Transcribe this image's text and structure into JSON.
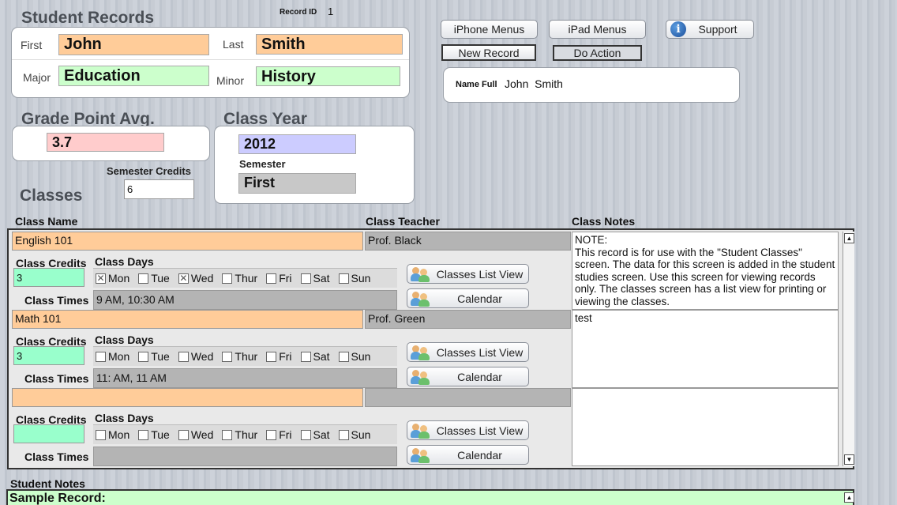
{
  "header": {
    "title": "Student Records",
    "record_id_label": "Record ID",
    "record_id": "1"
  },
  "name": {
    "first_label": "First",
    "first": "John",
    "last_label": "Last",
    "last": "Smith",
    "major_label": "Major",
    "major": "Education",
    "minor_label": "Minor",
    "minor": "History"
  },
  "toolbar": {
    "iphone_menus": "iPhone Menus",
    "ipad_menus": "iPad Menus",
    "support": "Support",
    "new_record": "New Record",
    "do_action": "Do Action"
  },
  "name_full": {
    "label": "Name Full",
    "value": "John  Smith"
  },
  "gpa": {
    "label": "Grade Point Avg.",
    "value": "3.7",
    "semester_credits_label": "Semester Credits",
    "semester_credits": "6"
  },
  "class_year": {
    "label": "Class Year",
    "value": "2012",
    "semester_label": "Semester",
    "semester": "First"
  },
  "classes": {
    "label": "Classes",
    "col_name": "Class Name",
    "col_teacher": "Class Teacher",
    "col_notes": "Class Notes",
    "credits_label": "Class Credits",
    "days_label": "Class Days",
    "times_label": "Class Times",
    "list_view_label": "Classes List View",
    "calendar_label": "Calendar",
    "day_names": [
      "Mon",
      "Tue",
      "Wed",
      "Thur",
      "Fri",
      "Sat",
      "Sun"
    ],
    "rows": [
      {
        "name": "English 101",
        "teacher": "Prof. Black",
        "notes": "NOTE:\nThis record is for use with the \"Student Classes\" screen. The data for this screen is added in the student studies screen. Use this screen for viewing records only. The classes screen has a list view for printing or viewing the classes.",
        "credits": "3",
        "days_checked": [
          true,
          false,
          true,
          false,
          false,
          false,
          false
        ],
        "times": "9 AM, 10:30 AM"
      },
      {
        "name": "Math 101",
        "teacher": "Prof. Green",
        "notes": "test",
        "credits": "3",
        "days_checked": [
          false,
          false,
          false,
          false,
          false,
          false,
          false
        ],
        "times": "11: AM, 11 AM"
      },
      {
        "name": "",
        "teacher": "",
        "notes": "",
        "credits": "",
        "days_checked": [
          false,
          false,
          false,
          false,
          false,
          false,
          false
        ],
        "times": ""
      }
    ]
  },
  "student_notes": {
    "label": "Student Notes",
    "value": "Sample Record:"
  },
  "colors": {
    "orange": "#ffcc99",
    "green": "#ccffcc",
    "pink": "#ffcccc",
    "lavender": "#ccccff",
    "mint": "#99ffcc"
  },
  "icons": {
    "support": "info-icon",
    "class_buttons": "people-icon"
  }
}
